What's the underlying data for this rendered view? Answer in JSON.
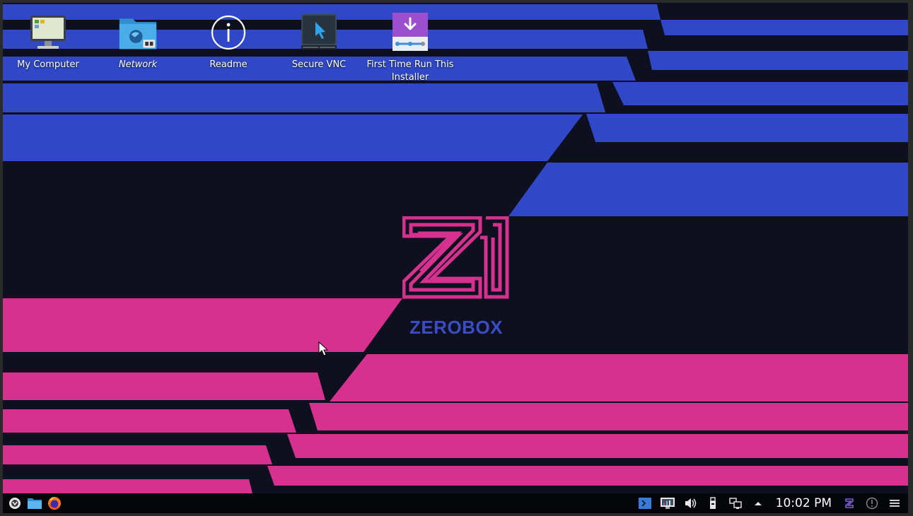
{
  "desktop": {
    "icons": [
      {
        "label": "My Computer",
        "icon": "computer-icon"
      },
      {
        "label": "Network",
        "icon": "network-folder-icon"
      },
      {
        "label": "Readme",
        "icon": "info-icon"
      },
      {
        "label": "Secure VNC",
        "icon": "vnc-icon"
      },
      {
        "label": "First Time Run This Installer",
        "icon": "installer-icon"
      }
    ]
  },
  "wallpaper": {
    "brand_text": "ZEROBOX",
    "colors": {
      "blue": "#3048c8",
      "pink": "#d6318e",
      "dark": "#0e1020",
      "logo_text": "#3a4dc4"
    }
  },
  "taskbar": {
    "launchers": [
      {
        "icon": "application-launcher-icon"
      },
      {
        "icon": "file-manager-icon"
      },
      {
        "icon": "firefox-icon"
      }
    ],
    "tray": [
      {
        "icon": "terminal-icon"
      },
      {
        "icon": "system-monitor-icon"
      },
      {
        "icon": "volume-icon"
      },
      {
        "icon": "usb-device-icon"
      },
      {
        "icon": "network-icon"
      },
      {
        "icon": "expand-tray-arrow-icon"
      }
    ],
    "clock": "10:02 PM",
    "extra": [
      {
        "icon": "zerobox-icon"
      },
      {
        "icon": "notifications-icon"
      },
      {
        "icon": "menu-icon"
      }
    ]
  }
}
